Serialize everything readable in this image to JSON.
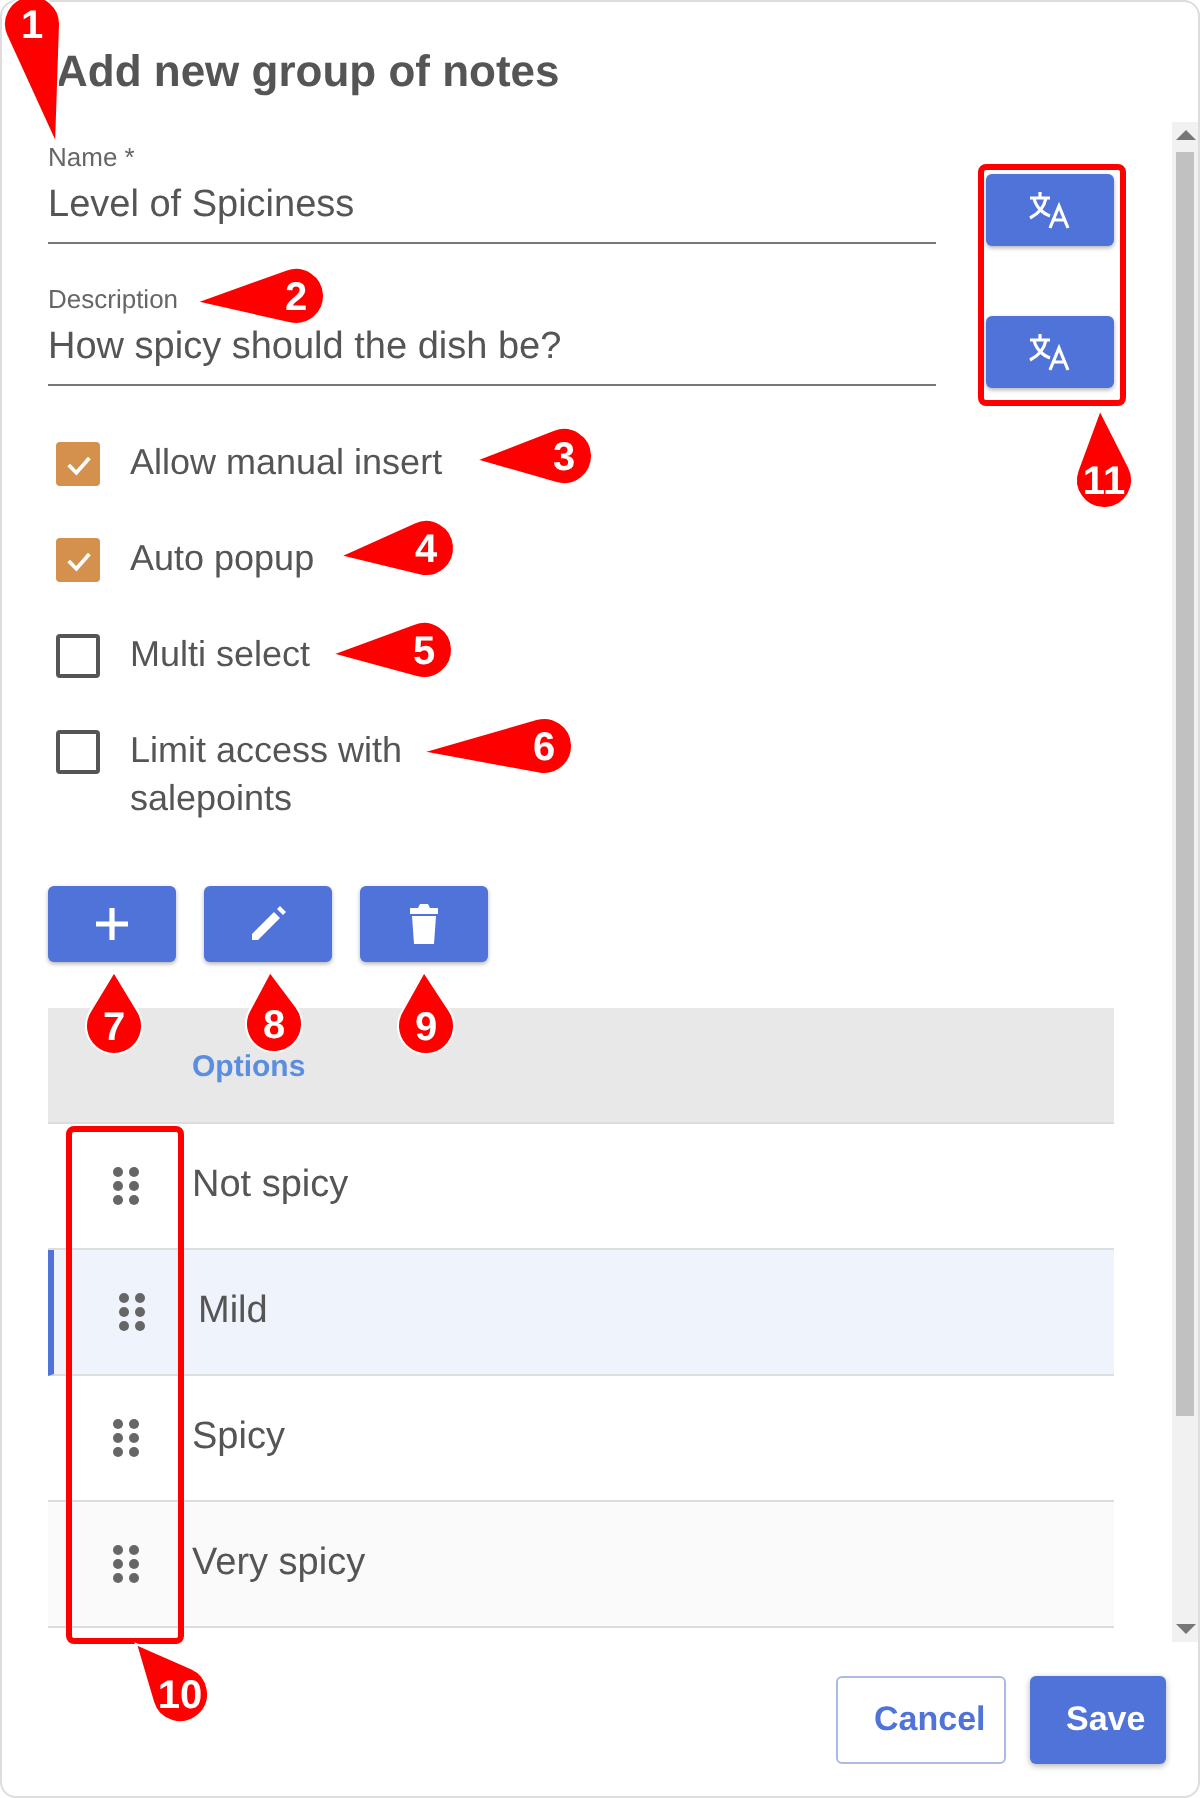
{
  "dialog": {
    "title": "Add new group of notes"
  },
  "fields": [
    {
      "label": "Name *",
      "value": "Level of Spiciness"
    },
    {
      "label": "Description",
      "value": "How spicy should the dish be?"
    }
  ],
  "checkboxes": [
    {
      "label": "Allow manual insert",
      "checked": true
    },
    {
      "label": "Auto popup",
      "checked": true
    },
    {
      "label": "Multi select",
      "checked": false
    },
    {
      "label": "Limit access with salepoints",
      "checked": false
    }
  ],
  "toolbar": [
    {
      "kind": "add"
    },
    {
      "kind": "edit"
    },
    {
      "kind": "delete"
    }
  ],
  "table": {
    "columns": [
      "Options"
    ],
    "rows": [
      {
        "text": "Not spicy",
        "selected": false
      },
      {
        "text": "Mild",
        "selected": true
      },
      {
        "text": "Spicy",
        "selected": false
      },
      {
        "text": "Very spicy",
        "selected": false
      }
    ]
  },
  "buttons": [
    {
      "label": "Cancel",
      "kind": "secondary"
    },
    {
      "label": "Save",
      "kind": "primary"
    }
  ],
  "callouts": [
    "1",
    "2",
    "3",
    "4",
    "5",
    "6",
    "7",
    "8",
    "9",
    "10",
    "11"
  ]
}
